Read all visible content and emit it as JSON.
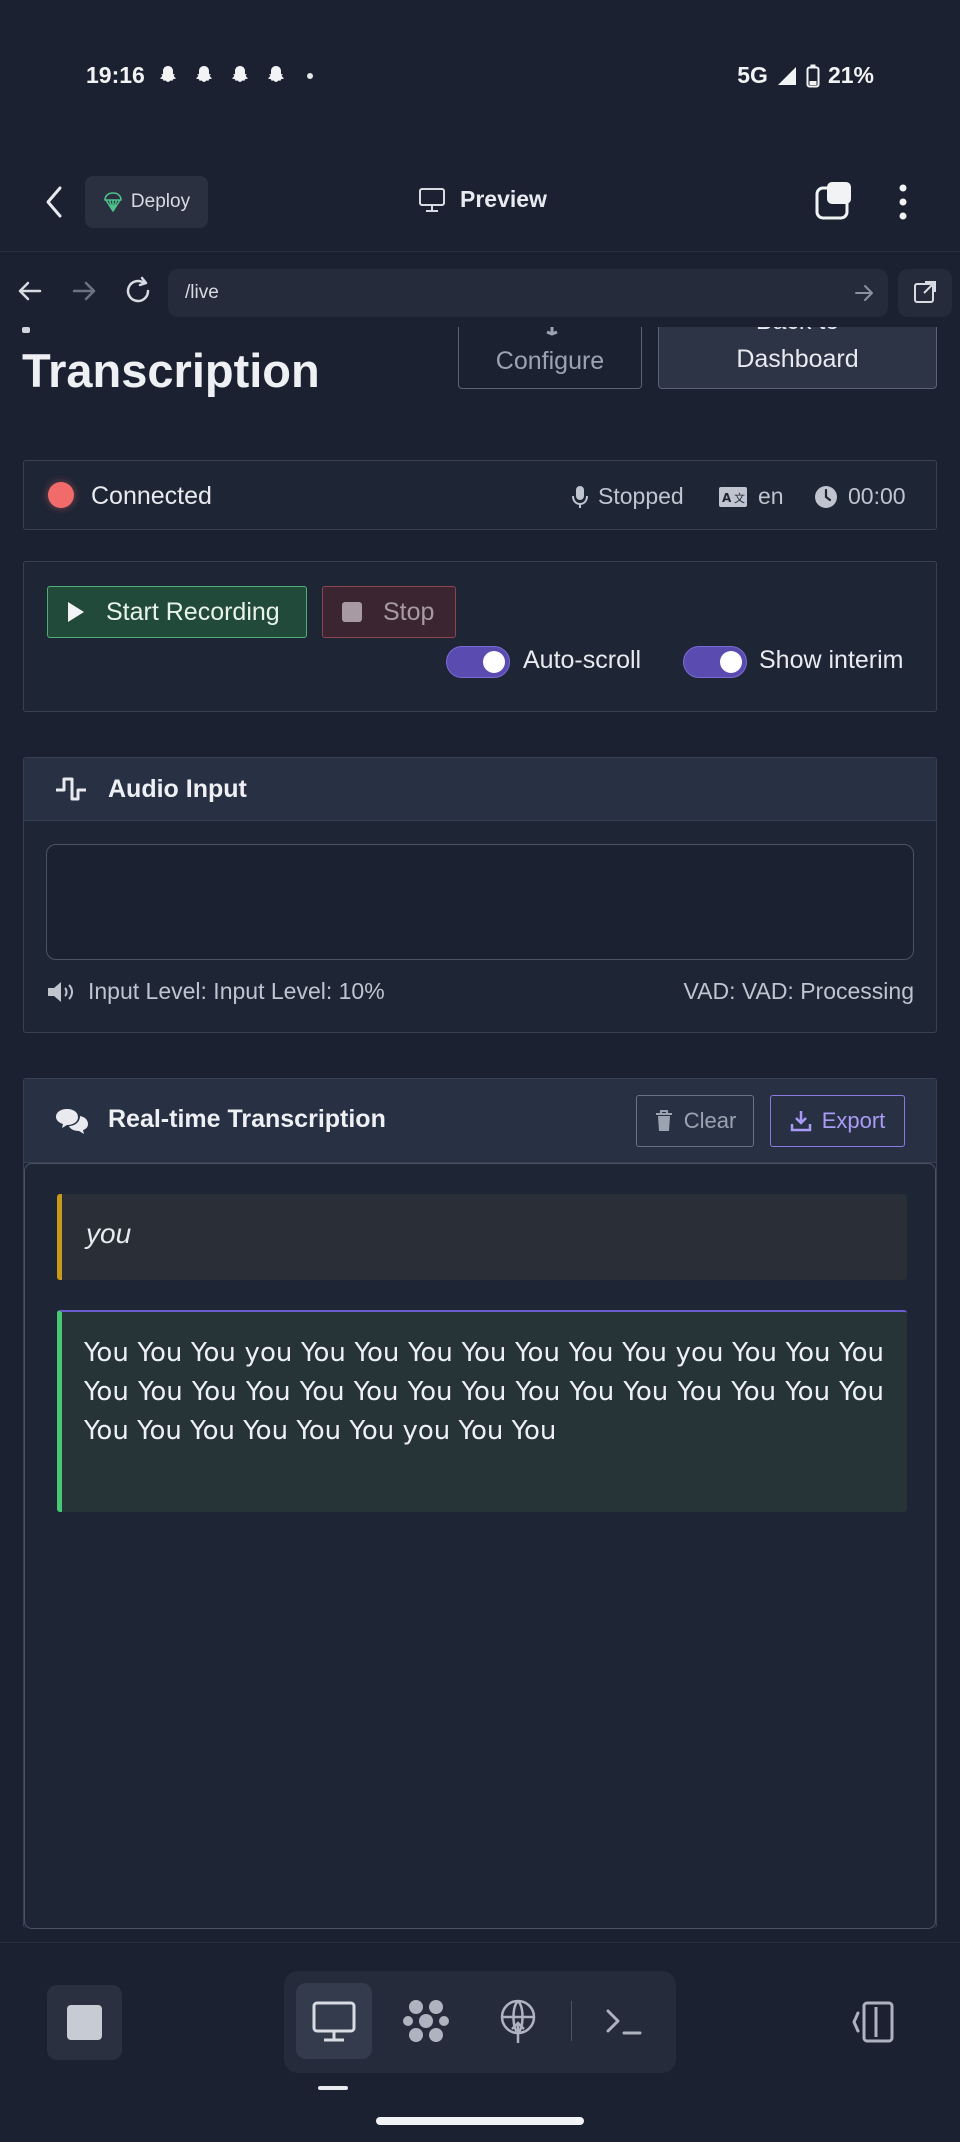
{
  "status_bar": {
    "time": "19:16",
    "network": "5G",
    "battery": "21%",
    "notification_icons": [
      "snapchat-icon",
      "snapchat-icon",
      "snapchat-icon",
      "snapchat-icon"
    ]
  },
  "app_header": {
    "deploy_label": "Deploy",
    "preview_label": "Preview"
  },
  "browser": {
    "url": "/live"
  },
  "page": {
    "title": "Transcription",
    "configure_label": "Configure",
    "back_label_line1": "Back to",
    "back_label_line2": "Dashboard"
  },
  "status": {
    "connection": "Connected",
    "recording_state": "Stopped",
    "language": "en",
    "elapsed": "00:00"
  },
  "controls": {
    "start_label": "Start Recording",
    "stop_label": "Stop",
    "autoscroll_label": "Auto-scroll",
    "autoscroll_on": true,
    "interim_label": "Show interim",
    "interim_on": true
  },
  "audio": {
    "title": "Audio Input",
    "level_text": "Input Level: Input Level: 10%",
    "vad_text": "VAD: VAD: Processing"
  },
  "transcription": {
    "title": "Real-time Transcription",
    "clear_label": "Clear",
    "export_label": "Export",
    "interim_text": "you",
    "final_text": "You You You you You You You You You You You you You You You You You You You You You You You You You You You You You You You You You You You You you You You"
  },
  "colors": {
    "background": "#1b2130",
    "connected_dot": "#f26b6b",
    "start_green": "#4caf74",
    "accent_purple": "#7a6ad6",
    "interim_border": "#c99a1a",
    "final_border": "#48c774"
  }
}
